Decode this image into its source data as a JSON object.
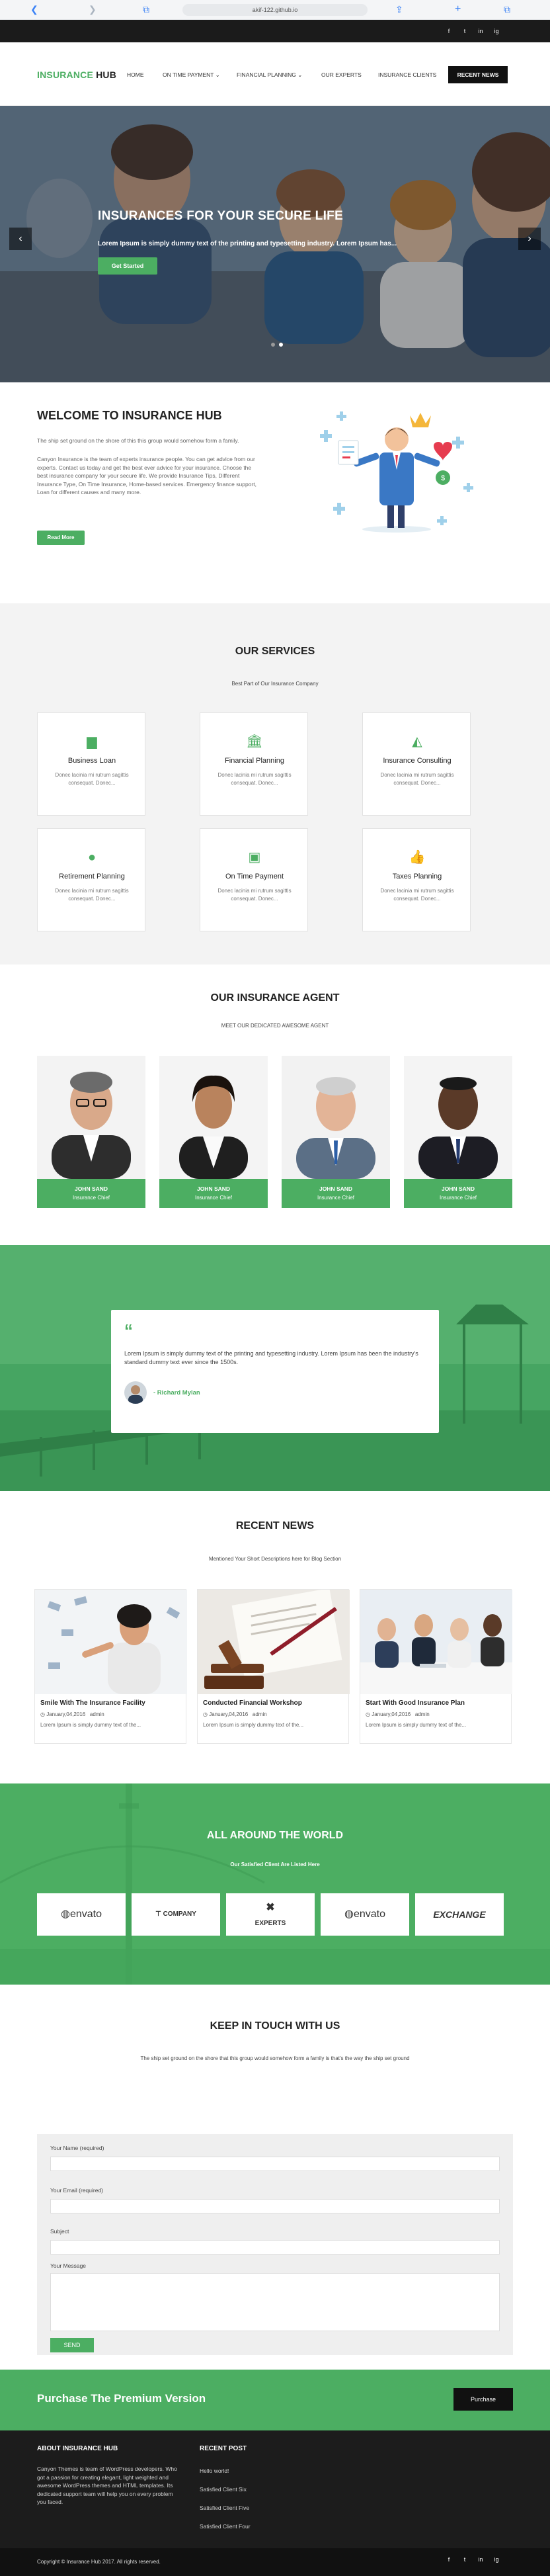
{
  "browser": {
    "url": "akif-122.github.io"
  },
  "top_social": [
    "f",
    "t",
    "in",
    "ig"
  ],
  "nav": {
    "logo_a": "INSURANCE",
    "logo_b": " HUB",
    "items": [
      "HOME",
      "ON TIME PAYMENT",
      "FINANCIAL PLANNING",
      "OUR EXPERTS",
      "INSURANCE CLIENTS"
    ],
    "dropdown_marker": "⌄",
    "button": "RECENT NEWS"
  },
  "hero": {
    "title": "INSURANCES FOR YOUR SECURE LIFE",
    "subtitle": "Lorem Ipsum is simply dummy text of the printing and typesetting industry. Lorem Ipsum has...",
    "button": "Get Started",
    "prev": "‹",
    "next": "›"
  },
  "welcome": {
    "title": "WELCOME TO INSURANCE HUB",
    "para1": "The ship set ground on the shore of this this group would somehow form a family.",
    "para2": "Canyon Insurance is the team of experts insurance people. You can get advice from our experts. Contact us today and get the best ever advice for your insurance. Choose the best insurance company for your secure life. We provide Insurance Tips, Different Insurance Type, On Time Insurance, Home-based services. Emergency finance support, Loan for different causes and many more.",
    "button": "Read More"
  },
  "services": {
    "title": "OUR SERVICES",
    "subtitle": "Best Part of Our Insurance Company",
    "items": [
      {
        "icon": "briefcase-icon",
        "title": "Business Loan",
        "desc": "Donec lacinia mi rutrum sagittis consequat. Donec..."
      },
      {
        "icon": "bank-icon",
        "title": "Financial Planning",
        "desc": "Donec lacinia mi rutrum sagittis consequat. Donec..."
      },
      {
        "icon": "area-chart-icon",
        "title": "Insurance Consulting",
        "desc": "Donec lacinia mi rutrum sagittis consequat. Donec..."
      },
      {
        "icon": "user-icon",
        "title": "Retirement Planning",
        "desc": "Donec lacinia mi rutrum sagittis consequat. Donec..."
      },
      {
        "icon": "money-icon",
        "title": "On Time Payment",
        "desc": "Donec lacinia mi rutrum sagittis consequat. Donec..."
      },
      {
        "icon": "thumbs-up-icon",
        "title": "Taxes Planning",
        "desc": "Donec lacinia mi rutrum sagittis consequat. Donec..."
      }
    ]
  },
  "agents": {
    "title": "OUR INSURANCE AGENT",
    "subtitle": "MEET OUR DEDICATED AWESOME AGENT",
    "items": [
      {
        "name": "JOHN SAND",
        "role": "Insurance Chief"
      },
      {
        "name": "JOHN SAND",
        "role": "Insurance Chief"
      },
      {
        "name": "JOHN SAND",
        "role": "Insurance Chief"
      },
      {
        "name": "JOHN SAND",
        "role": "Insurance Chief"
      }
    ]
  },
  "testimonial": {
    "quote_mark": "“",
    "text": "Lorem Ipsum is simply dummy text of the printing and typesetting industry. Lorem Ipsum has been the industry's standard dummy text ever since the 1500s.",
    "author": "- Richard Mylan"
  },
  "news": {
    "title": "RECENT NEWS",
    "subtitle": "Mentioned Your Short Descriptions here for Blog Section",
    "items": [
      {
        "title": "Smile With The Insurance Facility",
        "date": "January,04,2016",
        "author": "admin",
        "desc": "Lorem Ipsum is simply dummy text of the..."
      },
      {
        "title": "Conducted Financial Workshop",
        "date": "January,04,2016",
        "author": "admin",
        "desc": "Lorem Ipsum is simply dummy text of the..."
      },
      {
        "title": "Start With Good Insurance Plan",
        "date": "January,04,2016",
        "author": "admin",
        "desc": "Lorem Ipsum is simply dummy text of the..."
      }
    ]
  },
  "around": {
    "title": "ALL AROUND THE WORLD",
    "subtitle": "Our Satisfied Client Are Listed Here",
    "brands": [
      "envato",
      "COMPANY",
      "EXPERTS",
      "envato",
      "EXCHANGE"
    ]
  },
  "contact": {
    "title": "KEEP IN TOUCH WITH US",
    "text": "The ship set ground on the shore that this group would somehow form a family is that's the way the ship set ground",
    "name_label": "Your Name (required)",
    "email_label": "Your Email (required)",
    "subject_label": "Subject",
    "message_label": "Your Message",
    "send": "SEND"
  },
  "promo": {
    "title": "Purchase The Premium Version",
    "button": "Purchase"
  },
  "footer": {
    "about_title": "ABOUT INSURANCE HUB",
    "about_text": "Canyon Themes is team of WordPress developers. Who got a passion for creating elegant, light weighted and awesome WordPress themes and HTML templates. Its dedicated support team will help you on every problem you faced.",
    "posts_title": "RECENT POST",
    "posts": [
      "Hello world!",
      "Satisfied Client Six",
      "Satisfied Client Five",
      "Satisfied Client Four"
    ],
    "copyright": "Copyright © Insurance Hub 2017. All rights reserved."
  },
  "colors": {
    "accent": "#4cae62",
    "dark": "#1b1b1b"
  }
}
